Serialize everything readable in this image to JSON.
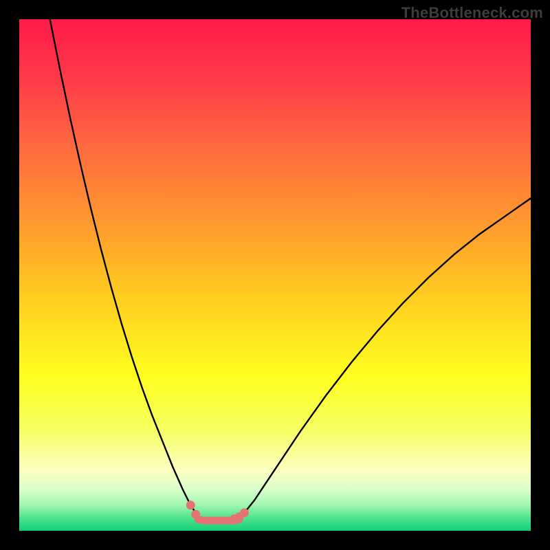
{
  "watermark": "TheBottleneck.com",
  "chart_data": {
    "type": "line",
    "title": "",
    "xlabel": "",
    "ylabel": "",
    "xlim": [
      0,
      100
    ],
    "ylim": [
      0,
      100
    ],
    "grid": false,
    "legend": false,
    "series": [
      {
        "name": "left-curve",
        "stroke": "#000000",
        "x": [
          6,
          8,
          10,
          12,
          14,
          16,
          18,
          20,
          22,
          24,
          26,
          28,
          30,
          32,
          33.5,
          34.5
        ],
        "values": [
          100,
          90,
          80.5,
          71.5,
          63,
          55,
          47.5,
          40.5,
          34,
          28,
          22.5,
          17.5,
          12.5,
          8,
          5,
          3.5
        ]
      },
      {
        "name": "right-curve",
        "stroke": "#000000",
        "x": [
          44,
          46,
          50,
          55,
          60,
          65,
          70,
          75,
          80,
          85,
          90,
          95,
          100
        ],
        "values": [
          3.5,
          6,
          12,
          19.5,
          26.5,
          33,
          39,
          44.5,
          49.5,
          54,
          58,
          61.5,
          65
        ]
      },
      {
        "name": "valley-floor",
        "stroke": "#e57373",
        "x": [
          35,
          36,
          37,
          38,
          39,
          40,
          41,
          42,
          43
        ],
        "values": [
          2.2,
          2.0,
          2.0,
          2.0,
          2.0,
          2.0,
          2.0,
          2.0,
          2.2
        ]
      }
    ],
    "markers": [
      {
        "name": "valley-dot-left-up",
        "x": 33.5,
        "y": 5.0,
        "color": "#e57373"
      },
      {
        "name": "valley-dot-left",
        "x": 34.5,
        "y": 3.2,
        "color": "#e57373"
      },
      {
        "name": "valley-dot-right-a",
        "x": 42.0,
        "y": 2.3,
        "color": "#e57373"
      },
      {
        "name": "valley-dot-right-b",
        "x": 43.0,
        "y": 2.7,
        "color": "#e57373"
      },
      {
        "name": "valley-dot-right-c",
        "x": 44.0,
        "y": 3.5,
        "color": "#e57373"
      }
    ],
    "gradient_stops": [
      {
        "offset": 0.0,
        "color": "#ff1a4a"
      },
      {
        "offset": 0.12,
        "color": "#ff3b4a"
      },
      {
        "offset": 0.25,
        "color": "#ff6a3f"
      },
      {
        "offset": 0.4,
        "color": "#ff9a2e"
      },
      {
        "offset": 0.55,
        "color": "#ffcf1f"
      },
      {
        "offset": 0.7,
        "color": "#ffff20"
      },
      {
        "offset": 0.8,
        "color": "#f6ff60"
      },
      {
        "offset": 0.88,
        "color": "#fdffc0"
      },
      {
        "offset": 0.92,
        "color": "#d8ffca"
      },
      {
        "offset": 0.95,
        "color": "#a0f5b0"
      },
      {
        "offset": 0.975,
        "color": "#4ee28e"
      },
      {
        "offset": 1.0,
        "color": "#12d178"
      }
    ]
  }
}
